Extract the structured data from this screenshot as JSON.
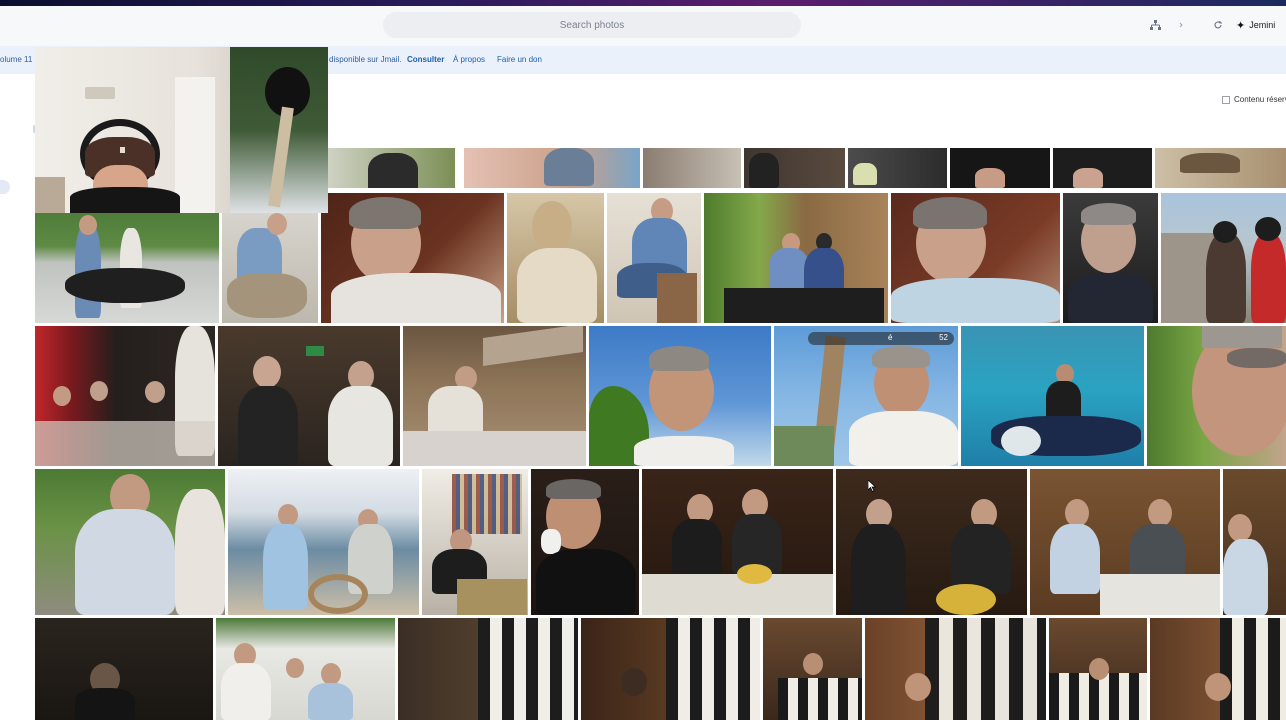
{
  "header": {
    "search_placeholder": "Search photos",
    "jemini_label": "Jemini",
    "jemini_icon": "sparkle-icon",
    "icons": [
      "hierarchy-icon",
      "chevron-icon",
      "refresh-icon"
    ]
  },
  "infobar": {
    "volume_text": "olume 11",
    "message": "disponible sur Jmail.",
    "links": [
      "Consulter",
      "À propos",
      "Faire un don"
    ]
  },
  "filter": {
    "label": "Contenu réserv"
  },
  "gallery": {
    "badge_left": "é",
    "badge_right": "52"
  },
  "colors": {
    "accent_link": "#1f5fae",
    "infobar_bg": "#eaf1fb",
    "appbar_bg": "#f7f8fa"
  }
}
